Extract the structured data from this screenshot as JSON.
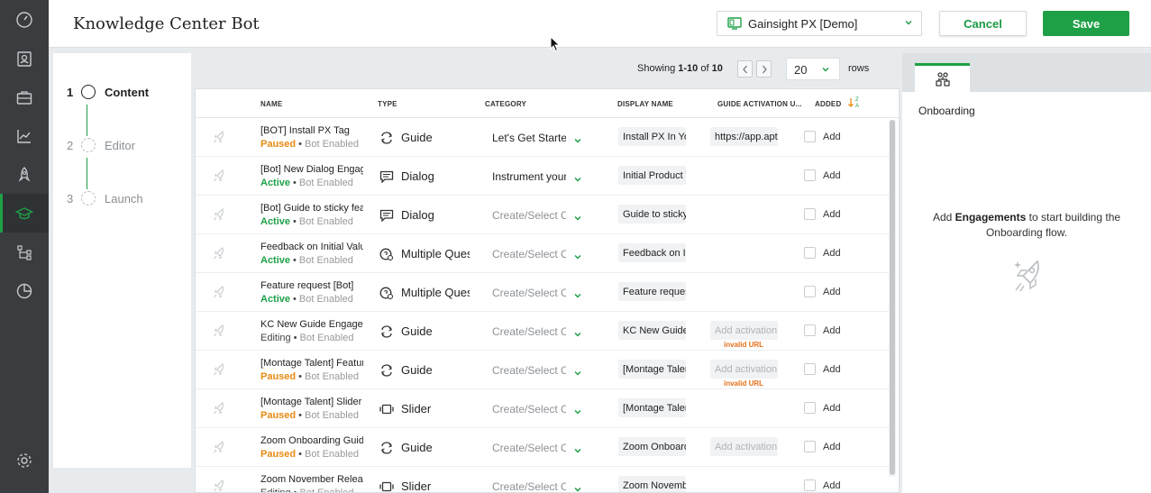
{
  "header": {
    "title": "Knowledge Center Bot",
    "app_selector": "Gainsight PX [Demo]",
    "cancel_label": "Cancel",
    "save_label": "Save"
  },
  "rail": {
    "icons": [
      "speedometer-icon",
      "user-card-icon",
      "briefcase-icon",
      "analytics-chart-icon",
      "rocket-icon",
      "graduation-cap-icon",
      "journey-tree-icon",
      "pie-chart-icon",
      "settings-gear-icon"
    ],
    "active": "graduation-cap-icon",
    "accent_color": "#1ea047"
  },
  "steps": [
    {
      "num": "1",
      "label": "Content",
      "current": true
    },
    {
      "num": "2",
      "label": "Editor",
      "current": false
    },
    {
      "num": "3",
      "label": "Launch",
      "current": false
    }
  ],
  "pager": {
    "showing_prefix": "Showing ",
    "showing_range": "1-10",
    "showing_of": " of ",
    "showing_total": "10",
    "rows_per_page": "20",
    "rows_label": "rows"
  },
  "table": {
    "columns": {
      "name": "NAME",
      "type": "TYPE",
      "category": "CATEGORY",
      "display_name": "DISPLAY NAME",
      "activation": "GUIDE ACTIVATION U...",
      "added": "ADDED"
    },
    "enabled_label": "Bot Enabled",
    "add_label": "Add",
    "rows": [
      {
        "name": "[BOT] Install PX Tag",
        "status": "Paused",
        "status_kind": "paused",
        "type": "Guide",
        "type_icon": "guide-icon",
        "category": "Let's Get Started",
        "category_kind": "filled",
        "display": "Install PX In Your Application",
        "activation": "https://app.aptrinsic.com",
        "activation_kind": "value",
        "invalid": ""
      },
      {
        "name": "[Bot] New Dialog Engagement",
        "status": "Active",
        "status_kind": "active",
        "type": "Dialog",
        "type_icon": "dialog-icon",
        "category": "Instrument your app",
        "category_kind": "filled",
        "display": "Initial Product Tour",
        "activation": "",
        "activation_kind": "none",
        "invalid": ""
      },
      {
        "name": "[Bot] Guide to sticky features",
        "status": "Active",
        "status_kind": "active",
        "type": "Dialog",
        "type_icon": "dialog-icon",
        "category": "Create/Select Category",
        "category_kind": "empty",
        "display": "Guide to sticky features",
        "activation": "",
        "activation_kind": "none",
        "invalid": ""
      },
      {
        "name": "Feedback on Initial Value",
        "status": "Active",
        "status_kind": "active",
        "type": "Multiple Questions",
        "type_icon": "survey-icon",
        "category": "Create/Select Category",
        "category_kind": "empty",
        "display": "Feedback on Initial Value",
        "activation": "",
        "activation_kind": "none",
        "invalid": ""
      },
      {
        "name": "Feature request [Bot]",
        "status": "Active",
        "status_kind": "active",
        "type": "Multiple Questions",
        "type_icon": "survey-icon",
        "category": "Create/Select Category",
        "category_kind": "empty",
        "display": "Feature request",
        "activation": "",
        "activation_kind": "none",
        "invalid": ""
      },
      {
        "name": "KC New Guide Engagement",
        "status": "Editing",
        "status_kind": "editing",
        "type": "Guide",
        "type_icon": "guide-icon",
        "category": "Create/Select Category",
        "category_kind": "empty",
        "display": "KC New Guide Engagement",
        "activation": "Add activation URL",
        "activation_kind": "placeholder",
        "invalid": "invalid URL"
      },
      {
        "name": "[Montage Talent] Feature Guide",
        "status": "Paused",
        "status_kind": "paused",
        "type": "Guide",
        "type_icon": "guide-icon",
        "category": "Create/Select Category",
        "category_kind": "empty",
        "display": "[Montage Talent] Feature Guide",
        "activation": "Add activation URL",
        "activation_kind": "placeholder",
        "invalid": "invalid URL"
      },
      {
        "name": "[Montage Talent] Slider",
        "status": "Paused",
        "status_kind": "paused",
        "type": "Slider",
        "type_icon": "slider-icon",
        "category": "Create/Select Category",
        "category_kind": "empty",
        "display": "[Montage Talent] Slider",
        "activation": "",
        "activation_kind": "none",
        "invalid": ""
      },
      {
        "name": "Zoom Onboarding Guide",
        "status": "Paused",
        "status_kind": "paused",
        "type": "Guide",
        "type_icon": "guide-icon",
        "category": "Create/Select Category",
        "category_kind": "empty",
        "display": "Zoom Onboarding Guide",
        "activation": "Add activation URL",
        "activation_kind": "placeholder",
        "invalid": ""
      },
      {
        "name": "Zoom November Release",
        "status": "Editing",
        "status_kind": "editing",
        "type": "Slider",
        "type_icon": "slider-icon",
        "category": "Create/Select Category",
        "category_kind": "empty",
        "display": "Zoom November Release",
        "activation": "",
        "activation_kind": "none",
        "invalid": ""
      }
    ]
  },
  "right_panel": {
    "tab_icon": "flow-org-icon",
    "title": "Onboarding",
    "empty_pre": "Add ",
    "empty_bold": "Engagements",
    "empty_post": " to start building the Onboarding flow.",
    "empty_icon": "rocket-icon"
  }
}
